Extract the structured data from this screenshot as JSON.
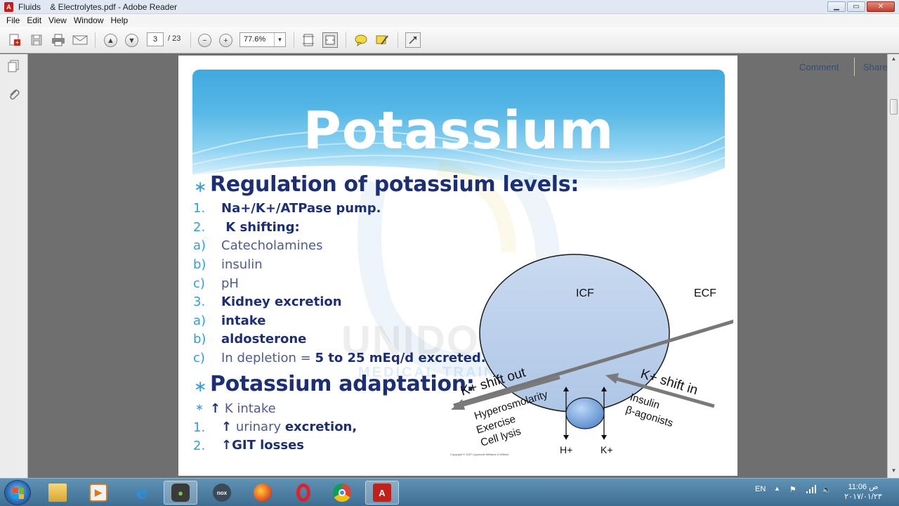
{
  "window": {
    "title": "Fluids    & Electrolytes.pdf - Adobe Reader",
    "app_icon_label": "A"
  },
  "menu": [
    "File",
    "Edit",
    "View",
    "Window",
    "Help"
  ],
  "toolbar": {
    "page_current": "3",
    "page_total": "/ 23",
    "zoom": "77.6%",
    "comment_label": "Comment",
    "share_label": "Share"
  },
  "slide": {
    "title": "Potassium",
    "heading1": "Regulation of potassium levels:",
    "items": [
      {
        "marker": "1.",
        "text": "Na+/K+/ATPase pump.",
        "style": "dark"
      },
      {
        "marker": "2.",
        "text": " K shifting:",
        "style": "dark"
      },
      {
        "marker": "a)",
        "text": "Catecholamines",
        "style": "light"
      },
      {
        "marker": "b)",
        "text": "insulin",
        "style": "light"
      },
      {
        "marker": "c)",
        "text": "pH",
        "style": "light"
      },
      {
        "marker": "3.",
        "text": "Kidney excretion",
        "style": "dark"
      },
      {
        "marker": "a)",
        "text": "intake",
        "style": "dark"
      },
      {
        "marker": "b)",
        "text": "aldosterone",
        "style": "dark"
      }
    ],
    "depletion_prefix": "In depletion = ",
    "depletion_value": "5 to 25 mEq/d excreted.",
    "heading2": "Potassium adaptation:",
    "adapt_items": [
      {
        "marker": "∗",
        "arrow": "↑",
        "text": " K intake",
        "bold": ""
      },
      {
        "marker": "1.",
        "arrow": "↑",
        "text": " urinary ",
        "bold": "excretion,"
      },
      {
        "marker": "2.",
        "arrow": "↑",
        "text": "",
        "bold": "GIT losses"
      }
    ],
    "watermark": "UNIDOS",
    "watermark_sub": "MEDICAL TRAINING",
    "copyright": "Copyright © 2007 Lippincott Williams & Wilkins."
  },
  "diagram": {
    "icf": "ICF",
    "ecf": "ECF",
    "shift_out": "K+ shift out",
    "shift_in": "K+ shift in",
    "out_causes": [
      "Hyperosmolarity",
      "Exercise",
      "Cell lysis"
    ],
    "in_causes": [
      "Insulin",
      "β-agonists"
    ],
    "h_label": "H+",
    "k_label": "K+"
  },
  "taskbar": {
    "apps": [
      "explorer",
      "media-player",
      "internet-explorer",
      "camtasia",
      "nox",
      "firefox",
      "opera",
      "chrome",
      "adobe-reader"
    ],
    "lang": "EN",
    "time": "11:06 ص",
    "date": "٢٠١٧/٠١/٢٣"
  }
}
